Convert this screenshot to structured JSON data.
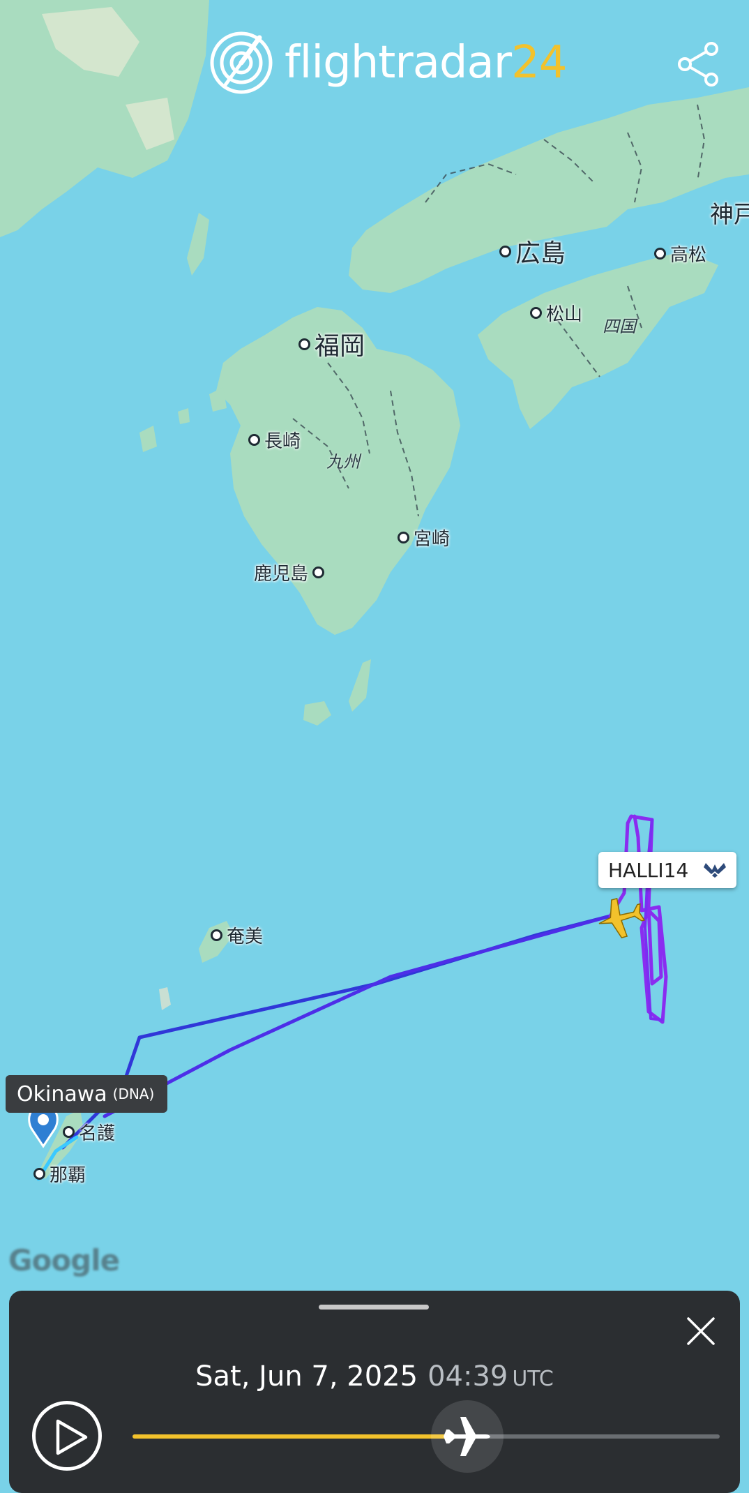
{
  "app": {
    "logo_text": "flightradar",
    "logo_number": "24"
  },
  "icons": {
    "logo": "radar-logo-icon",
    "share": "share-icon",
    "aircraft": "aircraft-icon",
    "operator": "air-force-emblem-icon",
    "airport_pin": "location-pin-icon",
    "close": "close-icon",
    "play": "play-icon",
    "scrubber": "airplane-icon"
  },
  "colors": {
    "sea": "#79d2e8",
    "land": "#a9dcbf",
    "track_purple": "#7a2cf0",
    "track_blue": "#2a3fdc",
    "accent_yellow": "#f2c22c",
    "panel": "#2b2e31"
  },
  "map_labels": {
    "kobe": "神戸",
    "hiroshima": "広島",
    "takamatsu": "高松",
    "matsuyama": "松山",
    "shikoku": "四国",
    "fukuoka": "福岡",
    "nagasaki": "長崎",
    "kyushu": "九州",
    "miyazaki": "宮崎",
    "kagoshima": "鹿児島",
    "amami": "奄美",
    "nago": "名護",
    "naha": "那覇"
  },
  "flight": {
    "callsign": "HALLI14"
  },
  "airport": {
    "name": "Okinawa",
    "code": "(DNA)"
  },
  "attribution": "Google",
  "playback": {
    "date": "Sat, Jun 7, 2025",
    "time": "04:39",
    "timezone": "UTC",
    "progress": 0.57
  }
}
